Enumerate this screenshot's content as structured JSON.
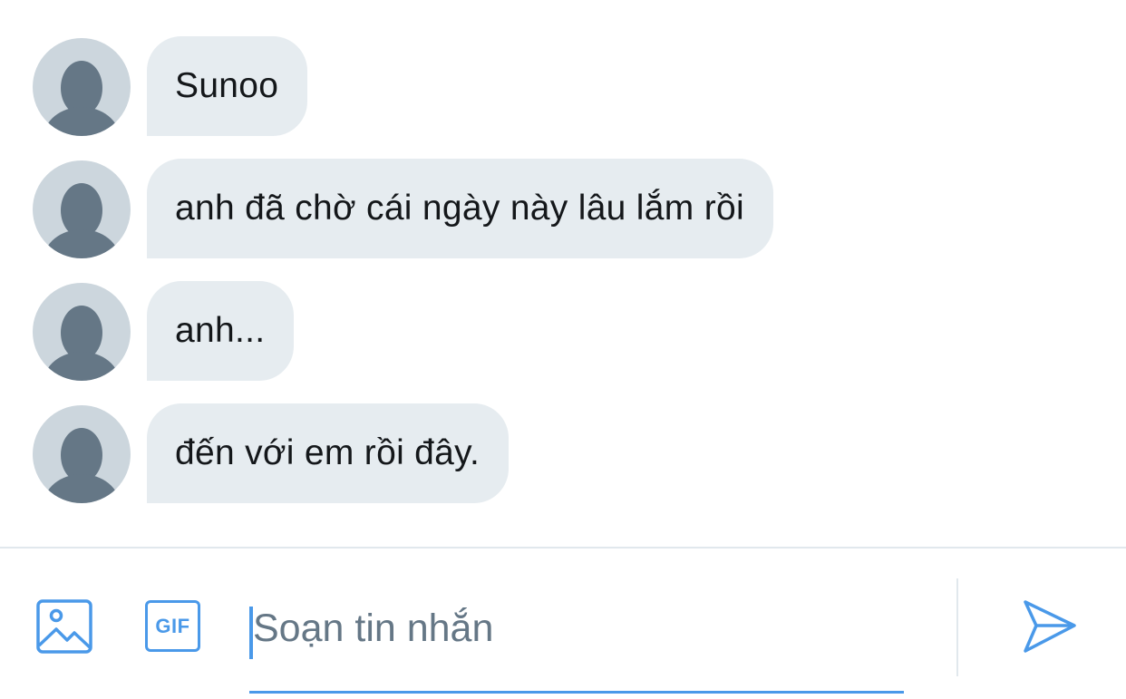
{
  "messages": [
    {
      "text": "Sunoo"
    },
    {
      "text": "anh đã chờ cái ngày này lâu lắm rồi"
    },
    {
      "text": "anh..."
    },
    {
      "text": "đến với em rồi đây."
    }
  ],
  "composer": {
    "placeholder": "Soạn tin nhắn",
    "gif_label": "GIF",
    "media_icon": "image-icon",
    "send_icon": "send-icon"
  },
  "colors": {
    "accent": "#4a99e9",
    "bubble": "#e6ecf0",
    "avatar_bg": "#ccd6dd",
    "avatar_fg": "#657786",
    "text": "#14171a"
  }
}
